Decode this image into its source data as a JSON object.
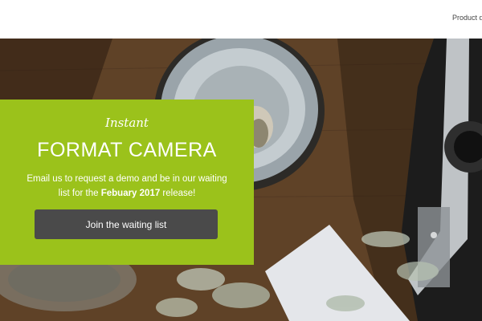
{
  "nav": {
    "product_link": "Product d"
  },
  "hero": {
    "tagline": "Instant",
    "title": "FORMAT CAMERA",
    "description_before": "Email us to request a demo and be in our waiting list for the ",
    "description_highlight": "Febuary 2017",
    "description_after": " release!",
    "cta_label": "Join the waiting list"
  },
  "colors": {
    "accent": "#9bc21b",
    "button": "#4a4a4a",
    "text_on_accent": "#ffffff"
  },
  "icons": [
    "bowl-photo",
    "camera-photo",
    "plant-photo"
  ]
}
